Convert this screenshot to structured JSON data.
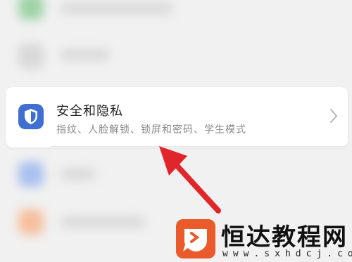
{
  "settings_item": {
    "title": "安全和隐私",
    "subtitle": "指纹、人脸解锁、锁屏和密码、学生模式",
    "icon": "shield-icon",
    "icon_color": "#3f6fd0"
  },
  "blurred_rows": [
    {
      "icon_color": "#9fd3a6"
    },
    {
      "icon_color": "#d8d8d8"
    },
    {
      "icon_color": "#a9c1ef"
    },
    {
      "icon_color": "#f6bf9e"
    }
  ],
  "annotation": {
    "icon": "arrow-icon",
    "color": "#e0262b"
  },
  "watermark": {
    "name": "恒达教程网",
    "url": "www.sxhdcj.com",
    "logo_color": "#ea5a2a"
  }
}
